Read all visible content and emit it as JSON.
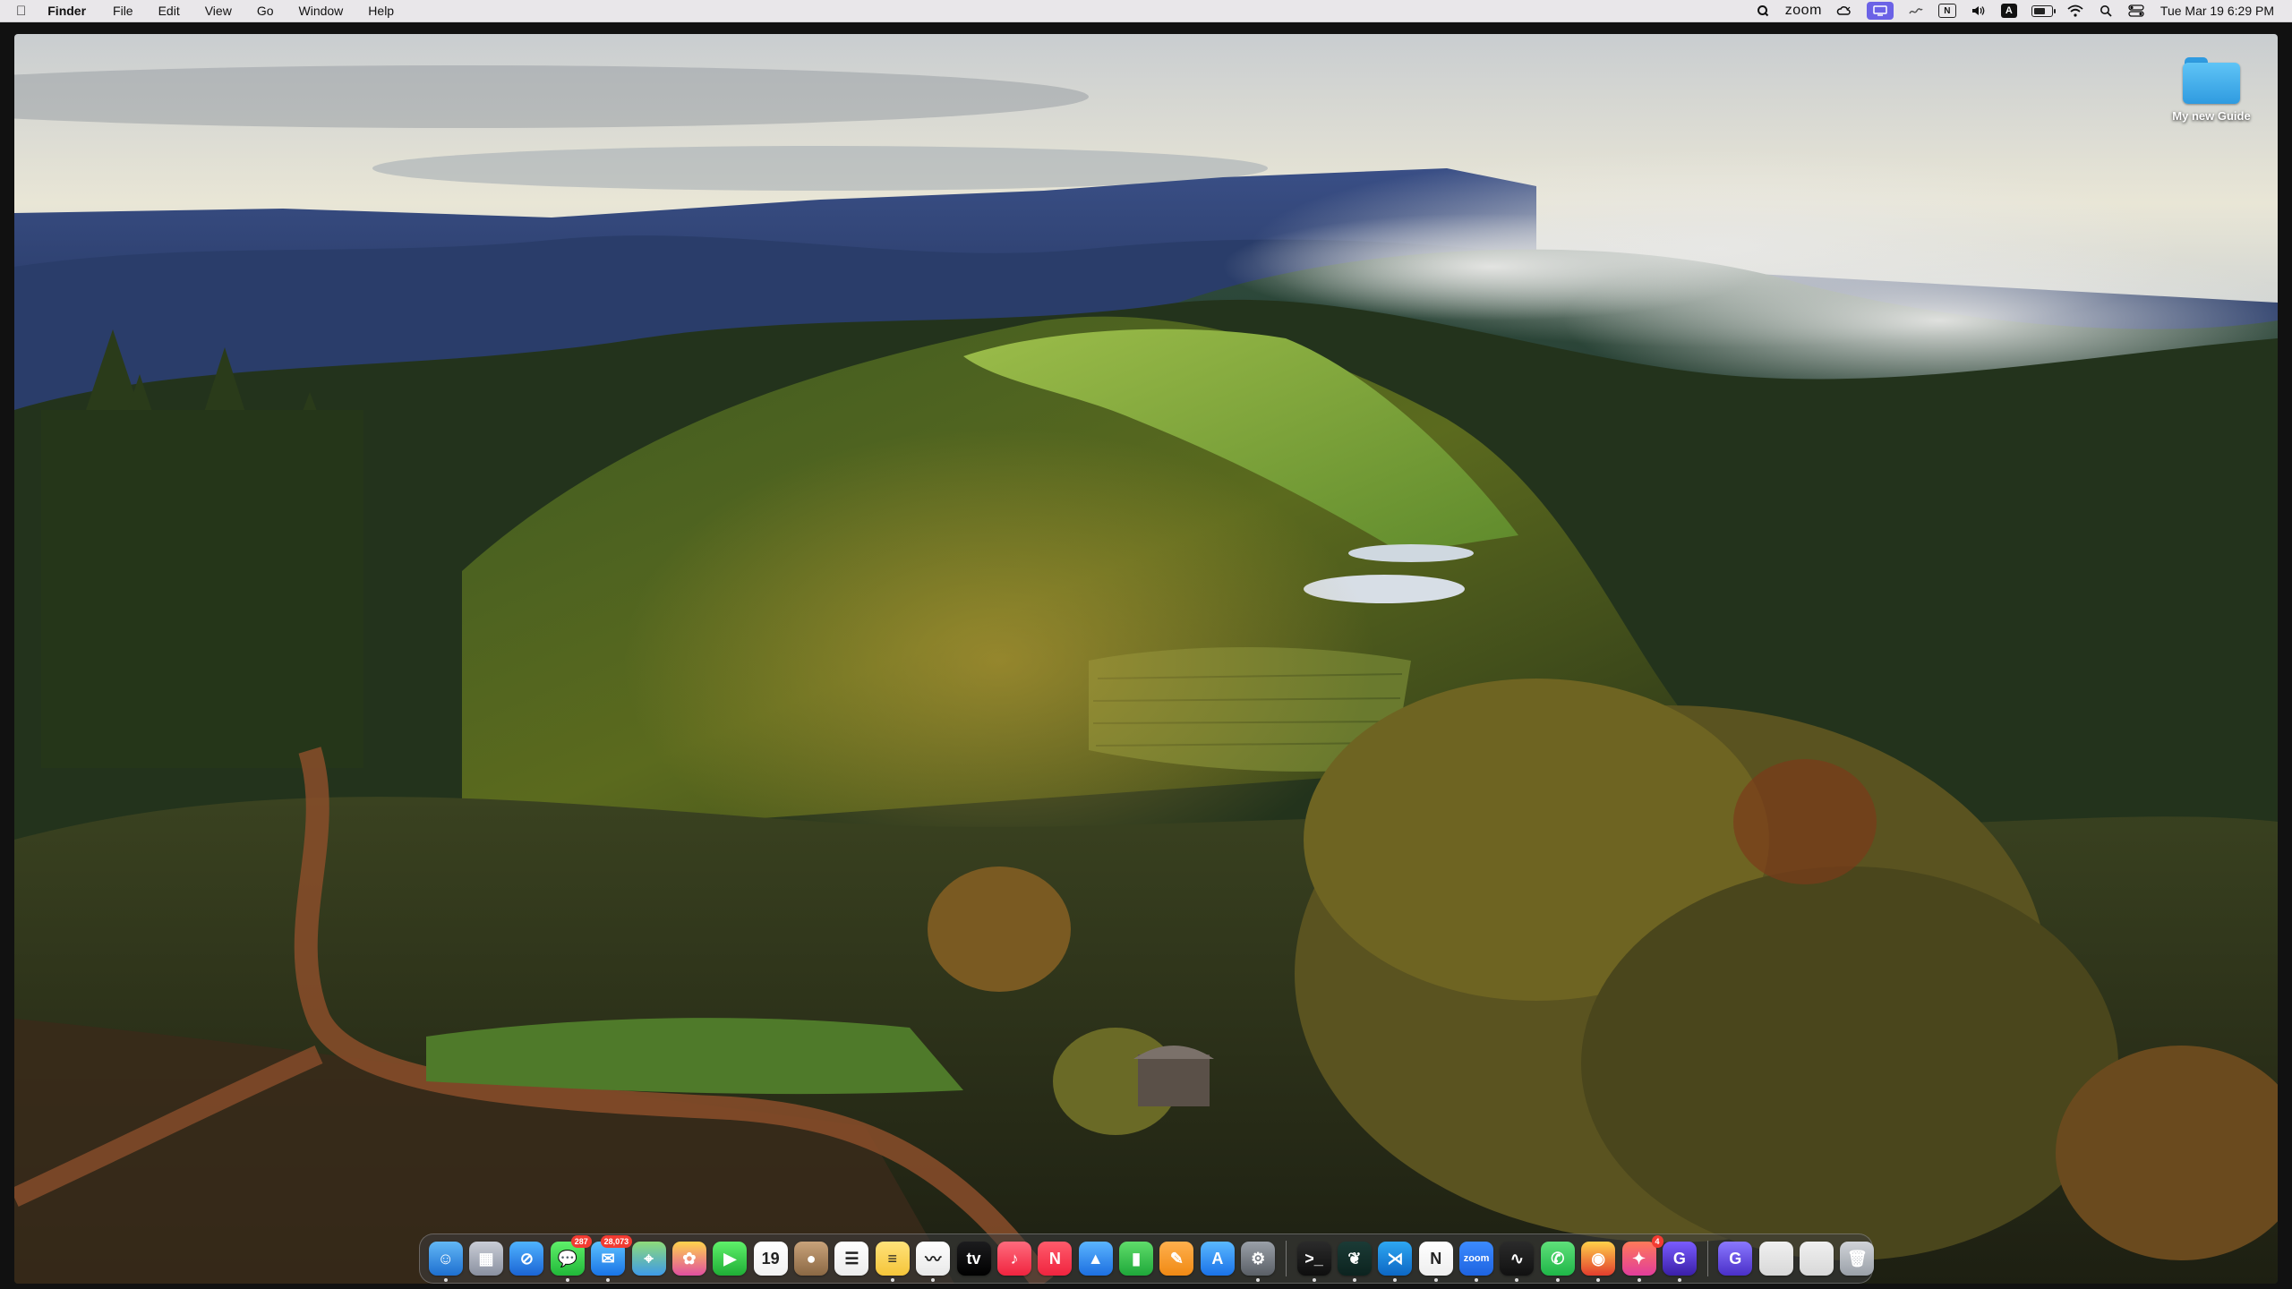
{
  "menubar": {
    "app_name": "Finder",
    "menus": [
      "File",
      "Edit",
      "View",
      "Go",
      "Window",
      "Help"
    ],
    "zoom_label": "zoom",
    "input_source": "A",
    "notion_letter": "N",
    "clock": "Tue Mar 19  6:29 PM",
    "battery_level": 0.75,
    "status_icons": [
      "quicktime-q-icon",
      "zoom-status",
      "weather-icon",
      "screen-share-icon",
      "stage-manager-icon",
      "notion-icon",
      "volume-icon",
      "input-source-icon",
      "battery-icon",
      "wifi-icon",
      "spotlight-icon",
      "control-center-icon"
    ]
  },
  "desktop": {
    "items": [
      {
        "label": "My new Guide",
        "icon": "folder-icon",
        "color": "#2f9be0"
      }
    ]
  },
  "dock": {
    "apps": [
      {
        "name": "finder-icon",
        "glyph": "☺",
        "colors": [
          "#62b7f5",
          "#1e6fd0"
        ],
        "running": true
      },
      {
        "name": "launchpad-icon",
        "glyph": "▦",
        "colors": [
          "#c9cdd6",
          "#8a90a0"
        ],
        "running": false
      },
      {
        "name": "safari-icon",
        "glyph": "⊘",
        "colors": [
          "#4fb3ff",
          "#1b64d4"
        ],
        "running": false
      },
      {
        "name": "messages-icon",
        "glyph": "💬",
        "colors": [
          "#5ff06a",
          "#21b839"
        ],
        "running": true,
        "badge": "287"
      },
      {
        "name": "mail-icon",
        "glyph": "✉",
        "colors": [
          "#5cc1ff",
          "#1974e6"
        ],
        "running": true,
        "badge": "28,073"
      },
      {
        "name": "maps-icon",
        "glyph": "⌖",
        "colors": [
          "#8edb7a",
          "#3e9ae8"
        ],
        "running": false
      },
      {
        "name": "photos-icon",
        "glyph": "✿",
        "colors": [
          "#ffd34d",
          "#e04fa0"
        ],
        "running": false
      },
      {
        "name": "facetime-icon",
        "glyph": "▶",
        "colors": [
          "#5ff06a",
          "#1fae36"
        ],
        "running": false
      },
      {
        "name": "calendar-icon",
        "glyph": "19",
        "colors": [
          "#ffffff",
          "#f2f2f2"
        ],
        "running": false,
        "dark_text": true
      },
      {
        "name": "contacts-icon",
        "glyph": "●",
        "colors": [
          "#c8a27a",
          "#8b6844"
        ],
        "running": false
      },
      {
        "name": "reminders-icon",
        "glyph": "☰",
        "colors": [
          "#ffffff",
          "#ececec"
        ],
        "running": false,
        "dark_text": true
      },
      {
        "name": "notes-icon",
        "glyph": "≡",
        "colors": [
          "#ffe27a",
          "#f5c53a"
        ],
        "running": true,
        "dark_text": true
      },
      {
        "name": "freeform-icon",
        "glyph": "〰",
        "colors": [
          "#ffffff",
          "#e8e8e8"
        ],
        "running": true,
        "dark_text": true
      },
      {
        "name": "apple-tv-icon",
        "glyph": "tv",
        "colors": [
          "#1c1c1e",
          "#000000"
        ],
        "running": false
      },
      {
        "name": "music-icon",
        "glyph": "♪",
        "colors": [
          "#ff6b7d",
          "#f0243f"
        ],
        "running": false
      },
      {
        "name": "news-icon",
        "glyph": "N",
        "colors": [
          "#ff5b6b",
          "#f0243f"
        ],
        "running": false
      },
      {
        "name": "keynote-icon",
        "glyph": "▲",
        "colors": [
          "#5ab4ff",
          "#1d6fe0"
        ],
        "running": false
      },
      {
        "name": "numbers-icon",
        "glyph": "▮",
        "colors": [
          "#5fdc6a",
          "#1fa83a"
        ],
        "running": false
      },
      {
        "name": "pages-icon",
        "glyph": "✎",
        "colors": [
          "#ffb04d",
          "#f08a14"
        ],
        "running": false
      },
      {
        "name": "app-store-icon",
        "glyph": "A",
        "colors": [
          "#5ab8ff",
          "#1a72e8"
        ],
        "running": false
      },
      {
        "name": "system-settings-icon",
        "glyph": "⚙",
        "colors": [
          "#9aa0a8",
          "#5a5f66"
        ],
        "running": true
      }
    ],
    "extra_apps": [
      {
        "name": "terminal-icon",
        "glyph": ">_",
        "colors": [
          "#2b2b2b",
          "#0e0e0e"
        ],
        "running": true
      },
      {
        "name": "mongodb-compass-icon",
        "glyph": "❦",
        "colors": [
          "#1b3b36",
          "#0c231f"
        ],
        "running": true
      },
      {
        "name": "vscode-icon",
        "glyph": "⋊",
        "colors": [
          "#2ea7f2",
          "#0d67c4"
        ],
        "running": true
      },
      {
        "name": "notion-app-icon",
        "glyph": "N",
        "colors": [
          "#ffffff",
          "#eeeeee"
        ],
        "running": true,
        "dark_text": true
      },
      {
        "name": "zoom-app-icon",
        "glyph": "zoom",
        "colors": [
          "#3c8bff",
          "#1e63e0"
        ],
        "running": true
      },
      {
        "name": "activity-monitor-icon",
        "glyph": "∿",
        "colors": [
          "#2b2b2b",
          "#111111"
        ],
        "running": true
      },
      {
        "name": "whatsapp-icon",
        "glyph": "✆",
        "colors": [
          "#5fe07a",
          "#1fb648"
        ],
        "running": true
      },
      {
        "name": "chrome-icon",
        "glyph": "◉",
        "colors": [
          "#ffd14a",
          "#e23d2d"
        ],
        "running": true
      },
      {
        "name": "craft-icon",
        "glyph": "✦",
        "colors": [
          "#ff7a59",
          "#e23d9b"
        ],
        "running": true,
        "badge": "4"
      },
      {
        "name": "quicktime-icon",
        "glyph": "G",
        "colors": [
          "#7a5cff",
          "#3a1fa8"
        ],
        "running": true
      }
    ],
    "right_items": [
      {
        "name": "quicktime-file-icon",
        "glyph": "G",
        "colors": [
          "#8a78ff",
          "#4a2fc8"
        ]
      },
      {
        "name": "window-thumbnail-1",
        "glyph": "",
        "colors": [
          "#f0f0f0",
          "#d8d8d8"
        ]
      },
      {
        "name": "window-thumbnail-2",
        "glyph": "",
        "colors": [
          "#f0f0f0",
          "#d8d8d8"
        ]
      },
      {
        "name": "trash-icon",
        "glyph": "🗑",
        "colors": [
          "#d0d3d8",
          "#9aa0a8"
        ]
      }
    ]
  }
}
